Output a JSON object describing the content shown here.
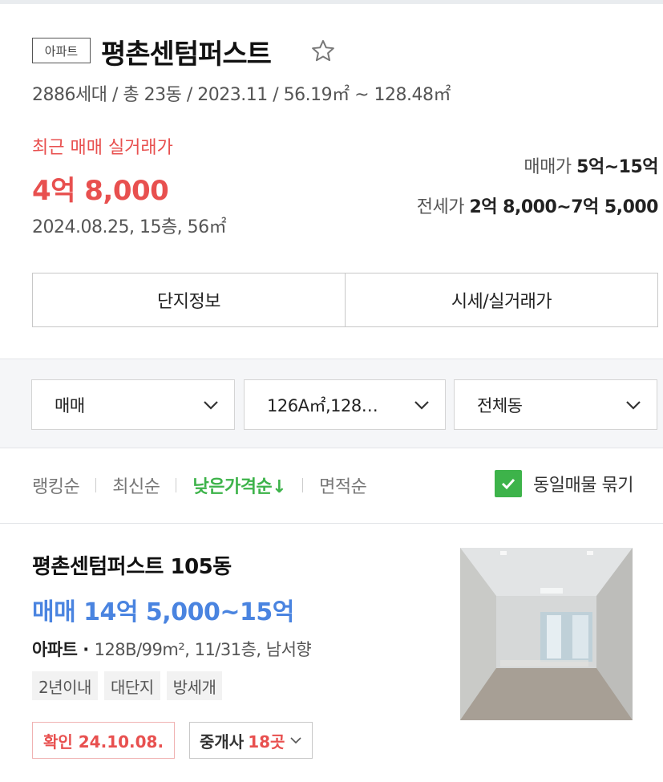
{
  "complex": {
    "type_badge": "아파트",
    "name": "평촌센텀퍼스트",
    "meta": "2886세대 / 총 23동 / 2023.11 / 56.19㎡ ~ 128.48㎡"
  },
  "recent_trade": {
    "label": "최근 매매 실거래가",
    "price": "4억 8,000",
    "detail": "2024.08.25, 15층, 56㎡"
  },
  "price_range": {
    "sale_label": "매매가",
    "sale_value": "5억~15억",
    "jeonse_label": "전세가",
    "jeonse_value": "2억 8,000~7억 5,000"
  },
  "tabs": [
    "단지정보",
    "시세/실거래가"
  ],
  "filters": {
    "trade_type": "매매",
    "area": "126A㎡,128…",
    "building": "전체동"
  },
  "sort": {
    "options": [
      "랭킹순",
      "최신순",
      "낮은가격순↓",
      "면적순"
    ],
    "active_index": 2,
    "group_label": "동일매물 묶기",
    "group_checked": true
  },
  "listing": {
    "title": "평촌센텀퍼스트 105동",
    "price": "매매 14억 5,000~15억",
    "spec_type": "아파트",
    "spec_detail": "128B/99m², 11/31층, 남서향",
    "tags": [
      "2년이내",
      "대단지",
      "방세개"
    ],
    "confirm": "확인 24.10.08.",
    "agent_label": "중개사",
    "agent_count": "18곳"
  },
  "colors": {
    "accent_red": "#e8504f",
    "accent_green": "#3db34a",
    "accent_blue": "#4a84e0"
  },
  "icons": [
    "star-outline-icon",
    "chevron-down-icon",
    "check-icon"
  ]
}
